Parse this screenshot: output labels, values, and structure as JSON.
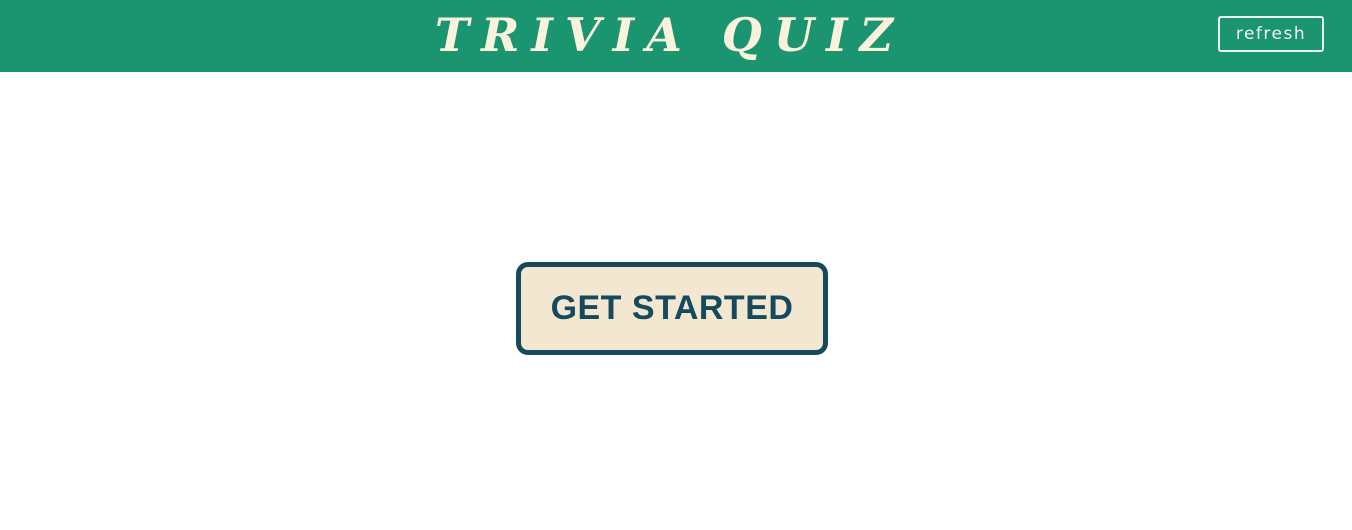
{
  "header": {
    "title": "TRIVIA QUIZ",
    "refresh_label": "refresh"
  },
  "main": {
    "start_label": "GET STARTED"
  },
  "colors": {
    "header_bg": "#1b9570",
    "title_text": "#fbf3dc",
    "button_bg": "#f3e7d2",
    "button_border": "#144a5c"
  }
}
